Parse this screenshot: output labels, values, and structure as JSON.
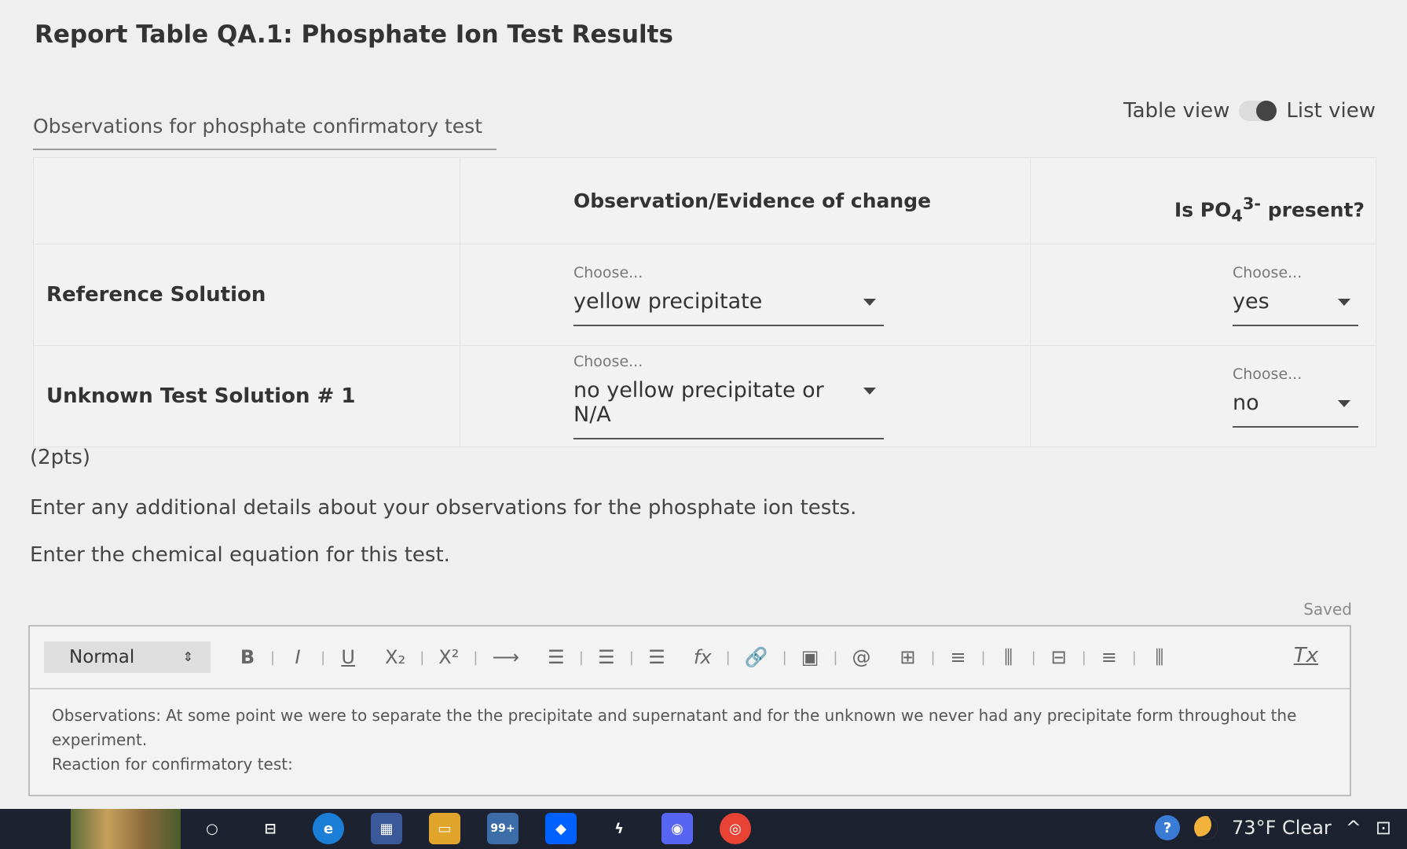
{
  "page_title": "Report Table QA.1: Phosphate Ion Test Results",
  "caption": "Observations for phosphate confirmatory test",
  "view_toggle": {
    "left": "Table view",
    "right": "List view"
  },
  "table": {
    "header_obs": "Observation/Evidence of change",
    "header_present_prefix": "Is PO",
    "header_present_sub": "4",
    "header_present_sup": "3-",
    "header_present_suffix": " present?",
    "rows": [
      {
        "label": "Reference Solution",
        "obs_hint": "Choose...",
        "obs_value": "yellow precipitate",
        "present_hint": "Choose...",
        "present_value": "yes"
      },
      {
        "label": "Unknown Test Solution # 1",
        "obs_hint": "Choose...",
        "obs_value": "no yellow precipitate or N/A",
        "present_hint": "Choose...",
        "present_value": "no"
      }
    ]
  },
  "points": "(2pts)",
  "instructions": [
    "Enter any additional details about your observations for the phosphate ion tests.",
    "Enter the chemical equation for this test."
  ],
  "saved_status": "Saved",
  "editor": {
    "format": "Normal",
    "toolbar": {
      "bold": "B",
      "italic": "I",
      "underline": "U",
      "subscript": "X₂",
      "superscript": "X²",
      "arrow": "⟶",
      "ordered_list": "☰",
      "unordered_list": "☰",
      "align": "☰",
      "formula": "fx",
      "link": "🔗",
      "image": "▣",
      "attach": "@",
      "table": "⊞",
      "clear_format": "Tx"
    },
    "body_lines": [
      "Observations: At some point we were to separate the the precipitate and supernatant and for the unknown we never had any precipitate form throughout the experiment.",
      "Reaction for confirmatory test:"
    ]
  },
  "taskbar": {
    "badge": "99+",
    "weather": "73°F Clear"
  },
  "colors": {
    "background": "#efefef",
    "taskbar": "#1d2230",
    "edge": "#1b7fd8",
    "chrome": "#e94335",
    "discord": "#5865f2",
    "dropbox": "#0061fe"
  }
}
